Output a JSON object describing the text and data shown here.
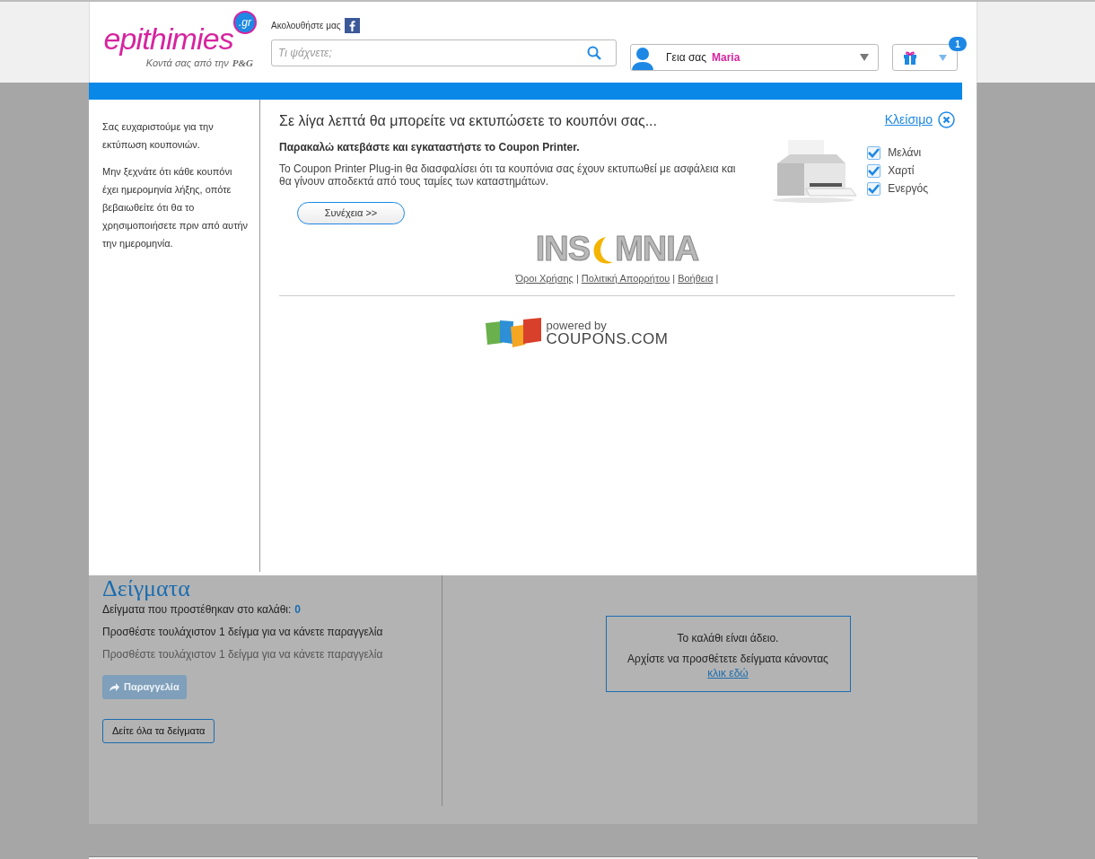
{
  "header": {
    "logo": {
      "name": "epithimies",
      "domain": ".gr",
      "tagline": "Κοντά σας από την",
      "brand": "P&G"
    },
    "follow": "Ακολουθήστε μας",
    "search": {
      "placeholder": "Τι ψάχνετε;"
    },
    "user": {
      "greeting": "Γεια σας",
      "name": "Maria"
    },
    "gifts": {
      "badge": "1"
    }
  },
  "page": {
    "title": "Δείγματα",
    "count_label": "Δείγματα που προστέθηκαν στο καλάθι:",
    "count": "0",
    "notes": [
      {
        "text": "Προσθέστε τουλάχιστον 1 δείγμα για να κάνετε παραγγελία",
        "muted": false
      },
      {
        "text": "Προσθέστε τουλάχιστον 1 δείγμα για να κάνετε παραγγελία",
        "muted": true
      }
    ],
    "order_button": {
      "label": "Παραγγελία",
      "disabled": true
    },
    "all_samples_button": "Δείτε όλα τα δείγματα",
    "cart": {
      "empty": "Το καλάθι είναι άδειο.",
      "hint": "Αρχίστε να προσθέτετε δείγματα κάνοντας",
      "link": "κλικ εδώ"
    }
  },
  "modal": {
    "sidebar": [
      "Σας ευχαριστούμε για την εκτύπωση κουπονιών.",
      "Μην ξεχνάτε ότι κάθε κουπόνι έχει ημερομηνία λήξης, οπότε βεβαιωθείτε ότι θα το χρησιμοποιήσετε πριν από αυτήν την ημερομηνία."
    ],
    "title": "Σε λίγα λεπτά θα μπορείτε να εκτυπώσετε το κουπόνι σας...",
    "close": "Κλείσιμο",
    "instruction": "Παρακαλώ κατεβάστε και εγκαταστήστε το Coupon Printer.",
    "description": "Το Coupon Printer Plug-in θα διασφαλίσει ότι τα κουπόνια σας έχουν εκτυπωθεί με ασφάλεια και θα γίνουν αποδεκτά από τους ταμίες των καταστημάτων.",
    "checks": [
      {
        "label": "Μελάνι",
        "checked": true
      },
      {
        "label": "Χαρτί",
        "checked": true
      },
      {
        "label": "Ενεργός",
        "checked": true
      }
    ],
    "continue": "Συνέχεια >>",
    "sponsor_logo": [
      "INS",
      "MNIA"
    ],
    "links": [
      "Όροι Χρήσης",
      "Πολιτική Απορρήτου",
      "Βοήθεια"
    ],
    "link_separator": "|",
    "powered": {
      "line1": "powered by",
      "line2": "COUPONS.COM"
    }
  }
}
